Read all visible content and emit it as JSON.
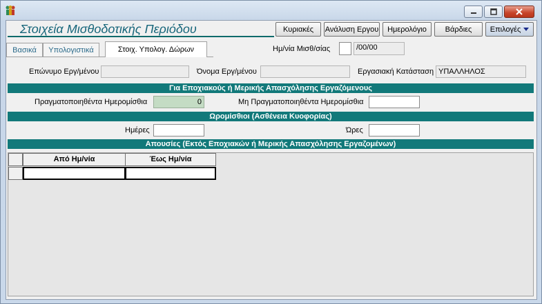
{
  "toolbar": {
    "sundays_label": "Κυριακές",
    "work_analysis_label": "Ανάλυση Εργου",
    "calendar_label": "Ημερολόγιο",
    "shifts_label": "Βάρδιες",
    "options_label": "Επιλογές"
  },
  "page": {
    "title": "Στοιχεία Μισθοδοτικής Περιόδου"
  },
  "tabs": [
    {
      "label": "Βασικά"
    },
    {
      "label": "Υπολογιστικά"
    },
    {
      "label": "Στοιχ. Υπολογ. Δώρων"
    }
  ],
  "payroll_date": {
    "label": "Ημ/νία Μισθ/σίας",
    "day_value": "",
    "value": "/00/00"
  },
  "employee": {
    "surname_label": "Επώνυμο Εργ/μένου",
    "surname_value": "",
    "name_label": "Όνομα Εργ/μένου",
    "name_value": "",
    "status_label": "Εργασιακή Κατάσταση",
    "status_value": "ΥΠΑΛΛΗΛΟΣ"
  },
  "seasonal": {
    "header": "Για Εποχιακούς ή Μερικής Απασχόλησης Εργαζόμενους",
    "realized_label": "Πραγματοποιηθέντα Ημερομίσθια",
    "realized_value": "0",
    "unrealized_label": "Μη Πραγματοποιηθέντα Ημερομίσθια",
    "unrealized_value": ""
  },
  "hourly": {
    "header": "Ωρομίσθιοι (Ασθένεια Κυοφορίας)",
    "days_label": "Ημέρες",
    "days_value": "",
    "hours_label": "Ώρες",
    "hours_value": ""
  },
  "absences": {
    "header": "Απουσίες (Εκτός Εποχιακών ή Μερικής Απασχόλησης Εργαζομένων)",
    "columns": [
      "Από Ημ/νία",
      "Έως Ημ/νία"
    ],
    "rows": [
      [
        "",
        ""
      ]
    ]
  },
  "colors": {
    "section_bg": "#12797a",
    "title_color": "#16657a"
  }
}
